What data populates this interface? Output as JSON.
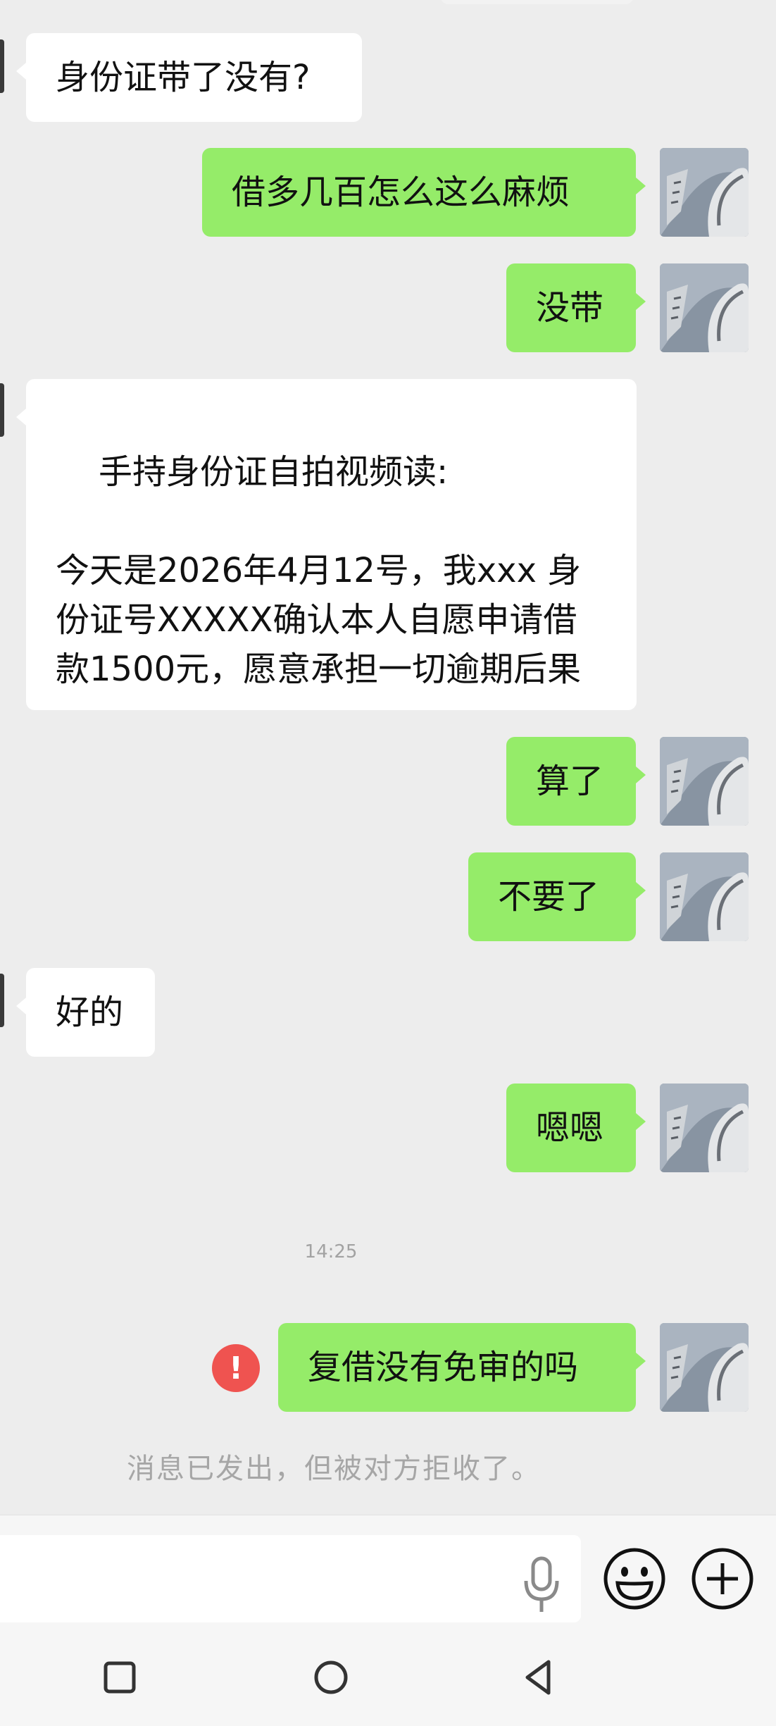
{
  "messages": [
    {
      "side": "in",
      "text": "身份证带了没有?"
    },
    {
      "side": "out",
      "text": "借多几百怎么这么麻烦"
    },
    {
      "side": "out",
      "text": "没带"
    },
    {
      "side": "in",
      "text": "手持身份证自拍视频读:\n\n今天是2026年4月12号，我xxx 身份证号XXXXX确认本人自愿申请借款1500元，愿意承担一切逾期后果"
    },
    {
      "side": "out",
      "text": "算了"
    },
    {
      "side": "out",
      "text": "不要了"
    },
    {
      "side": "in",
      "text": "好的"
    },
    {
      "side": "out",
      "text": "嗯嗯"
    },
    {
      "side": "out",
      "text": "复借没有免审的吗",
      "status": "rejected"
    }
  ],
  "timestamp": "14:25",
  "system_note": "消息已发出，但被对方拒收了。",
  "error_mark": "!",
  "icons": {
    "voice": "microphone-icon",
    "emoji": "emoji-icon",
    "more": "plus-icon",
    "nav_recent": "square-icon",
    "nav_home": "circle-icon",
    "nav_back": "triangle-back-icon"
  },
  "colors": {
    "outgoing_bubble": "#95ec69",
    "incoming_bubble": "#ffffff",
    "background": "#ededed",
    "error": "#ef5350"
  }
}
